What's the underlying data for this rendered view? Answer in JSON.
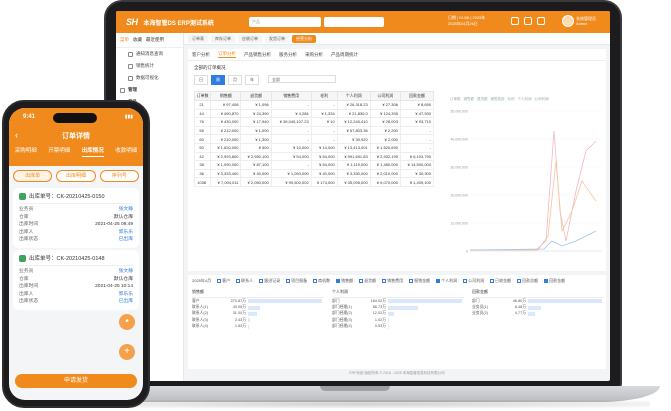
{
  "desktop": {
    "logo": "SH",
    "app_title": "本海智管DS ERP测试系统",
    "search_placeholder": "产品",
    "top_info_1": "日期 | 01/26 | 2025年",
    "top_info_2": "2025年04月26日",
    "user_name": "系统管理员",
    "user_role": "Admin",
    "sidebar_tabs": [
      "菜单",
      "收藏",
      "最近使用"
    ],
    "sidebar_items": [
      {
        "label": "通知消息查询",
        "group": false
      },
      {
        "label": "销售统计",
        "group": false
      },
      {
        "label": "数据可视化",
        "group": false
      },
      {
        "label": "管理",
        "group": true
      },
      {
        "label": "产品",
        "group": true
      }
    ],
    "tabs": [
      "订单表",
      "库存订单",
      "应收订单",
      "发货订单",
      "经营分析"
    ],
    "subtabs": [
      "客户分析",
      "订单分析",
      "产品销售分析",
      "服务分析",
      "采购分析",
      "产品周期统计"
    ],
    "section_title": "全部的订单概况",
    "filter_buttons": [
      "日",
      "周",
      "月",
      "年"
    ],
    "date_value": "全部",
    "table": {
      "headers": [
        "订单数",
        "销售额",
        "退货额",
        "销售费用",
        "毛利",
        "个人利润",
        "公司利润",
        "回款金额"
      ],
      "rows": [
        [
          "21",
          "¥ 97,408",
          "¥ 1,096",
          "-",
          "-",
          "¥ 26,318.23",
          "¥ 27,306",
          "¥ 8,690"
        ],
        [
          "44",
          "¥ 490,870",
          "¥ 24,390",
          "¥ 4,284",
          "¥ 1,334",
          "¥ 21,830.0",
          "¥ 124,395",
          "¥ 47,930"
        ],
        [
          "76",
          "¥ 430,000",
          "¥ 17,940",
          "¥ 39,045,107.23",
          "¥ 10",
          "¥ 12,240,410",
          "¥ 28,003",
          "¥ 93,710"
        ],
        [
          "55",
          "¥ 212,000",
          "¥ 1,000",
          "-",
          "-",
          "¥ 57,803.36",
          "¥ 2,200",
          "-"
        ],
        [
          "60",
          "¥ 210,000",
          "¥ 1,300",
          "-",
          "-",
          "¥ 39,920",
          "¥ 2,000",
          "-"
        ],
        [
          "50",
          "¥ 1,620,000",
          "¥ 500",
          "¥ 10,000",
          "¥ 14,000",
          "¥ 13,413,001",
          "¥ 1,520,690",
          "-"
        ],
        [
          "42",
          "¥ 2,993,800",
          "¥ 2,950,100",
          "¥ 54,000",
          "¥ 54,000",
          "¥ 991,691.83",
          "¥ 2,932,190",
          "¥ 6,103,790"
        ],
        [
          "38",
          "¥ 1,090,000",
          "¥ 87,100",
          "-",
          "¥ 54,000",
          "¥ 1,119,000",
          "¥ 1,480,000",
          "¥ 14,500,000"
        ],
        [
          "36",
          "¥ 3,333,400",
          "¥ 40,000",
          "¥ 1,093,000",
          "¥ 40,000",
          "¥ 3,330,000",
          "¥ 2,010,000",
          "¥ 30,300"
        ],
        [
          "1036",
          "¥ 7,094,011",
          "¥ 2,060,000",
          "¥ 99,500,002",
          "¥ 174,000",
          "¥ 35,095,000",
          "¥ 9,070,000",
          "¥ 1,409,100"
        ]
      ]
    },
    "chart_legend": [
      "订单数",
      "销售额",
      "退货额",
      "销售费用",
      "毛利",
      "个人利润",
      "公司利润"
    ],
    "chart_ylabels": [
      "50,000,000",
      "40,000,000",
      "30,000,000",
      "20,000,000",
      "10,000,000",
      "0"
    ],
    "bottom": {
      "period": "2025年4月",
      "filters": [
        {
          "label": "客户",
          "checked": false
        },
        {
          "label": "联系人",
          "checked": false
        },
        {
          "label": "跟进记录",
          "checked": false
        },
        {
          "label": "项目报备",
          "checked": false
        },
        {
          "label": "商机数",
          "checked": false
        },
        {
          "label": "销售额",
          "checked": true
        },
        {
          "label": "退货额",
          "checked": false
        },
        {
          "label": "销售费用",
          "checked": false
        },
        {
          "label": "报销金额",
          "checked": false
        },
        {
          "label": "个人利润",
          "checked": true
        },
        {
          "label": "公司利润",
          "checked": false
        },
        {
          "label": "已收金额",
          "checked": false
        },
        {
          "label": "回款总额",
          "checked": false
        },
        {
          "label": "回款金额",
          "checked": true
        }
      ],
      "mini_tables": [
        {
          "title": "销售额",
          "rows": [
            {
              "label": "客户",
              "value": "270.87万",
              "fill": 1.0
            },
            {
              "label": "联系人(1)",
              "value": "43.06万",
              "fill": 0.16
            },
            {
              "label": "联系人(2)",
              "value": "31.00万",
              "fill": 0.12
            },
            {
              "label": "联系人(3)",
              "value": "2.43万",
              "fill": 0.03
            },
            {
              "label": "联系人(4)",
              "value": "1.83万",
              "fill": 0.02
            }
          ]
        },
        {
          "title": "个人利润",
          "rows": [
            {
              "label": "部门",
              "value": "164.02万",
              "fill": 1.0
            },
            {
              "label": "部门经理(1)",
              "value": "66.73万",
              "fill": 0.4
            },
            {
              "label": "部门经理(2)",
              "value": "12.02万",
              "fill": 0.08
            },
            {
              "label": "部门经理(3)",
              "value": "1.02万",
              "fill": 0.02
            },
            {
              "label": "部门经理(4)",
              "value": "0.53万",
              "fill": 0.01
            }
          ]
        },
        {
          "title": "回款金额",
          "rows": [
            {
              "label": "部门",
              "value": "48.80万",
              "fill": 1.0
            },
            {
              "label": "业务员(1)",
              "value": "8.48万",
              "fill": 0.18
            },
            {
              "label": "业务员(2)",
              "value": "4.77万",
              "fill": 0.1
            }
          ]
        }
      ]
    },
    "footer": "ERP系统  版权所有 © 2018 - 2025 本海智管信息科技有限公司"
  },
  "phone": {
    "time": "9:41",
    "status": "▮▮▮",
    "title": "订单详情",
    "tabs": [
      "采购明细",
      "开票明细",
      "出库情况",
      "收款明细"
    ],
    "active_tab": 2,
    "segments": [
      "出库单",
      "出库明细",
      "序列号"
    ],
    "cards": [
      {
        "code": "出库单号：CK-20210425-0150",
        "fields": [
          {
            "k": "业务员",
            "v": "张文静",
            "link": true
          },
          {
            "k": "仓库",
            "v": "默认仓库",
            "link": false
          },
          {
            "k": "出库时间",
            "v": "2021-04-25 09:49",
            "link": false
          },
          {
            "k": "出库人",
            "v": "郭乐乐",
            "link": true
          },
          {
            "k": "出库状态",
            "v": "已出库",
            "link": true
          }
        ]
      },
      {
        "code": "出库单号：CK-20210425-0148",
        "fields": [
          {
            "k": "业务员",
            "v": "张文静",
            "link": true
          },
          {
            "k": "仓库",
            "v": "默认仓库",
            "link": false
          },
          {
            "k": "出库时间",
            "v": "2021-04-25 10:14",
            "link": false
          },
          {
            "k": "出库人",
            "v": "郭乐乐",
            "link": true
          },
          {
            "k": "出库状态",
            "v": "已出库",
            "link": true
          }
        ]
      }
    ],
    "fab_icon": "+",
    "submit_label": "申请发货"
  }
}
